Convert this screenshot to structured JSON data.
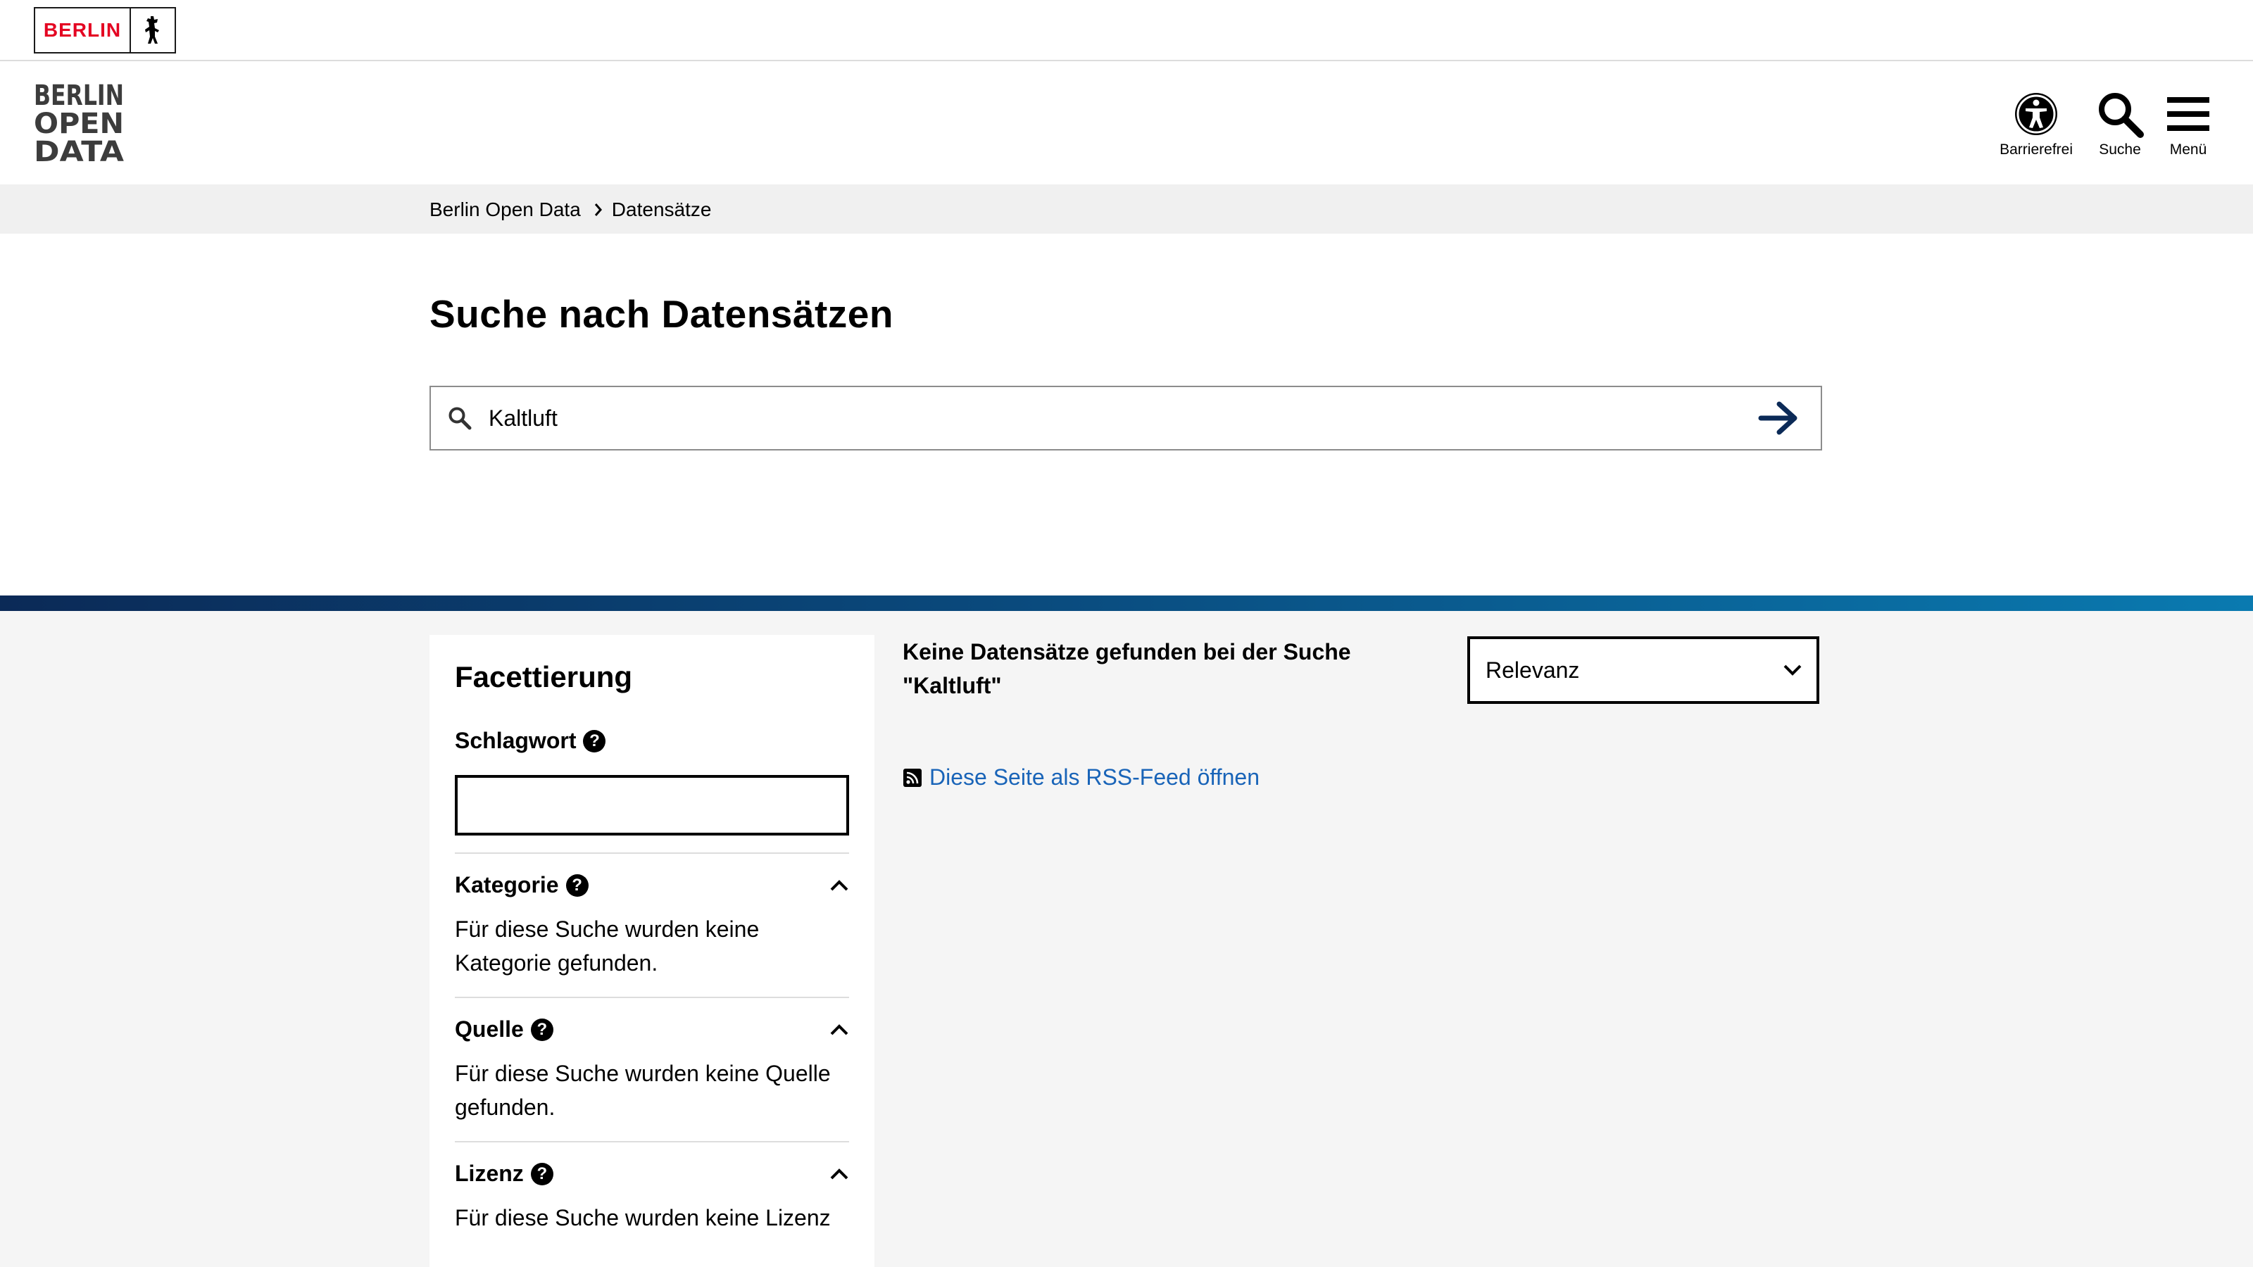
{
  "top_bar": {
    "berlin_logo_text": "BERLIN"
  },
  "header": {
    "logo_lines": [
      "BERLIN",
      "OPEN",
      "DATA"
    ],
    "actions": [
      {
        "label": "Barrierefrei",
        "icon": "accessibility-icon"
      },
      {
        "label": "Suche",
        "icon": "search-icon"
      },
      {
        "label": "Menü",
        "icon": "menu-icon"
      }
    ]
  },
  "breadcrumb": {
    "home": "Berlin Open Data",
    "current": "Datensätze"
  },
  "search": {
    "title": "Suche nach Datensätzen",
    "value": "Kaltluft",
    "submit_icon": "arrow-right-icon"
  },
  "facets": {
    "title": "Facettierung",
    "keyword_label": "Schlagwort",
    "keyword_value": "",
    "groups": [
      {
        "label": "Kategorie",
        "text": "Für diese Suche wurden keine Kategorie gefunden."
      },
      {
        "label": "Quelle",
        "text": "Für diese Suche wurden keine Quelle gefunden."
      },
      {
        "label": "Lizenz",
        "text": "Für diese Suche wurden keine Lizenz"
      }
    ]
  },
  "results": {
    "message": "Keine Datensätze gefunden bei der Suche \"Kaltluft\"",
    "sort_value": "Relevanz",
    "rss_label": "Diese Seite als RSS-Feed öffnen"
  },
  "colors": {
    "berlin_red": "#e40422",
    "link_blue": "#1964b8",
    "arrow_navy": "#0b2a57"
  }
}
